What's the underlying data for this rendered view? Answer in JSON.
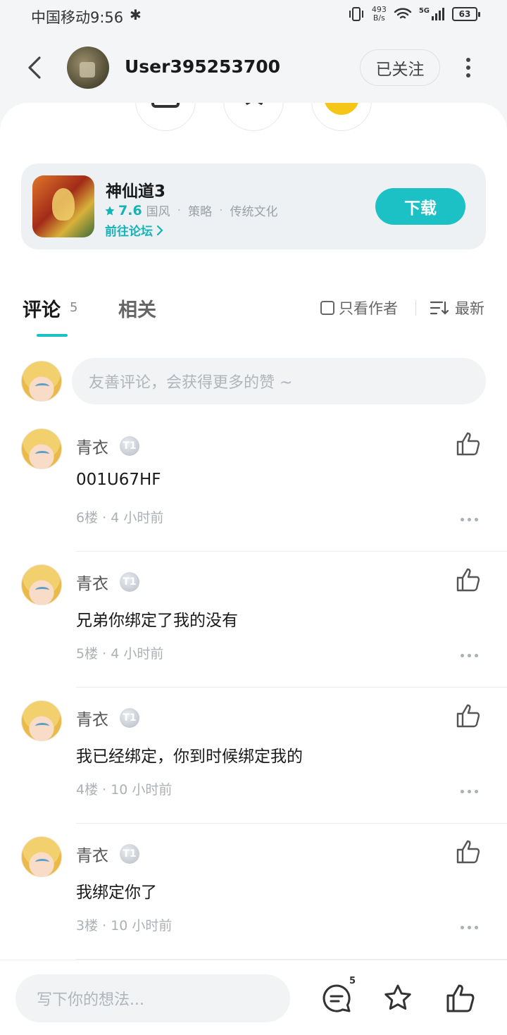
{
  "status_bar": {
    "carrier_time": "中国移动9:56",
    "bluetooth": "✱",
    "net_speed_value": "493",
    "net_speed_unit": "B/s",
    "signal": "5G",
    "battery": "63"
  },
  "header": {
    "username": "User395253700",
    "follow_label": "已关注"
  },
  "game_card": {
    "name": "神仙道3",
    "rating": "7.6",
    "tags": [
      "国风",
      "策略",
      "传统文化"
    ],
    "forum_link": "前往论坛",
    "download_label": "下载"
  },
  "comments_section": {
    "tab_comment": "评论",
    "tab_comment_count": "5",
    "tab_related": "相关",
    "author_only_label": "只看作者",
    "sort_label": "最新",
    "input_placeholder": "友善评论，会获得更多的赞 ~",
    "items": [
      {
        "name": "青衣",
        "badge": "T1",
        "text": "001U67HF",
        "floor": "6楼",
        "time": "4 小时前"
      },
      {
        "name": "青衣",
        "badge": "T1",
        "text": "兄弟你绑定了我的没有",
        "floor": "5楼",
        "time": "4 小时前"
      },
      {
        "name": "青衣",
        "badge": "T1",
        "text": "我已经绑定，你到时候绑定我的",
        "floor": "4楼",
        "time": "10 小时前"
      },
      {
        "name": "青衣",
        "badge": "T1",
        "text": "我绑定你了",
        "floor": "3楼",
        "time": "10 小时前"
      }
    ]
  },
  "bottom_bar": {
    "write_placeholder": "写下你的想法...",
    "comment_count": "5"
  },
  "colors": {
    "accent": "#1cc1c6",
    "gold": "#f5c518"
  }
}
